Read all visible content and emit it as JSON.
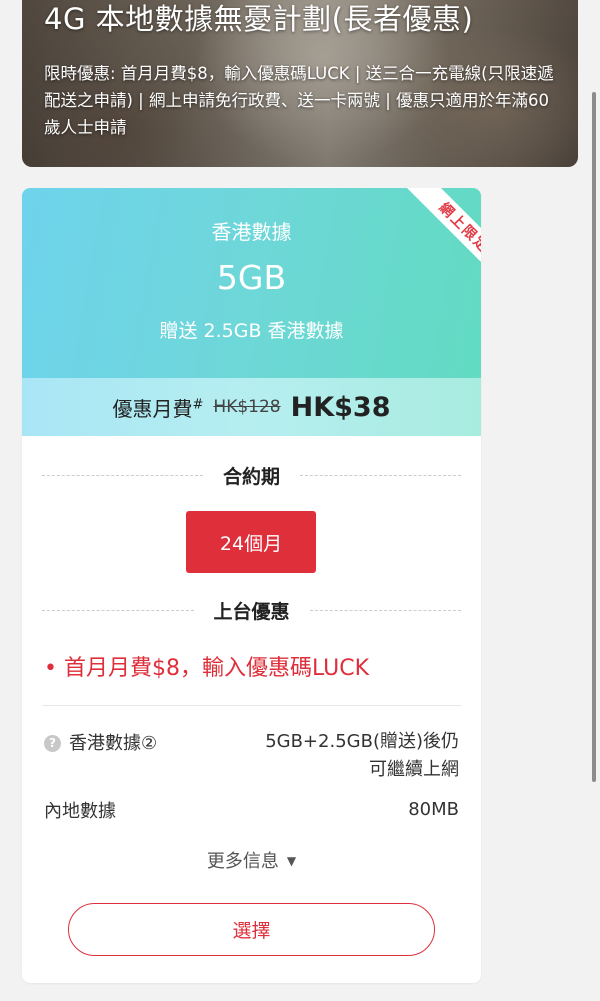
{
  "hero": {
    "title": "4G 本地數據無憂計劃(長者優惠)",
    "description": "限時優惠: 首月月費$8，輸入優惠碼LUCK | 送三合一充電線(只限速遞配送之申請) | 網上申請免行政費、送一卡兩號 | 優惠只適用於年滿60歲人士申請"
  },
  "plan": {
    "ribbon": "網上限定",
    "data_label": "香港數據",
    "data_amount": "5GB",
    "data_bonus": "贈送 2.5GB 香港數據",
    "price_label": "優惠月費",
    "price_mark": "#",
    "price_original": "HK$128",
    "price_offer": "HK$38",
    "contract_heading": "合約期",
    "contract_option": "24個月",
    "offer_heading": "上台優惠",
    "promo_text": "• 首月月費$8，輸入優惠碼LUCK",
    "details": {
      "hk_data_help": "?",
      "hk_data_label": "香港數據②",
      "hk_data_value_line1": "5GB+2.5GB(贈送)後仍",
      "hk_data_value_line2": "可繼續上網",
      "mainland_data_label": "內地數據",
      "mainland_data_value": "80MB"
    },
    "more_info": "更多信息",
    "select_button": "選擇"
  },
  "colors": {
    "accent_red": "#de2f3b",
    "card_gradient_start": "#6ed3ec",
    "card_gradient_end": "#62dbc2"
  },
  "icons": {
    "help": "question-circle-icon",
    "more": "caret-down-icon"
  }
}
